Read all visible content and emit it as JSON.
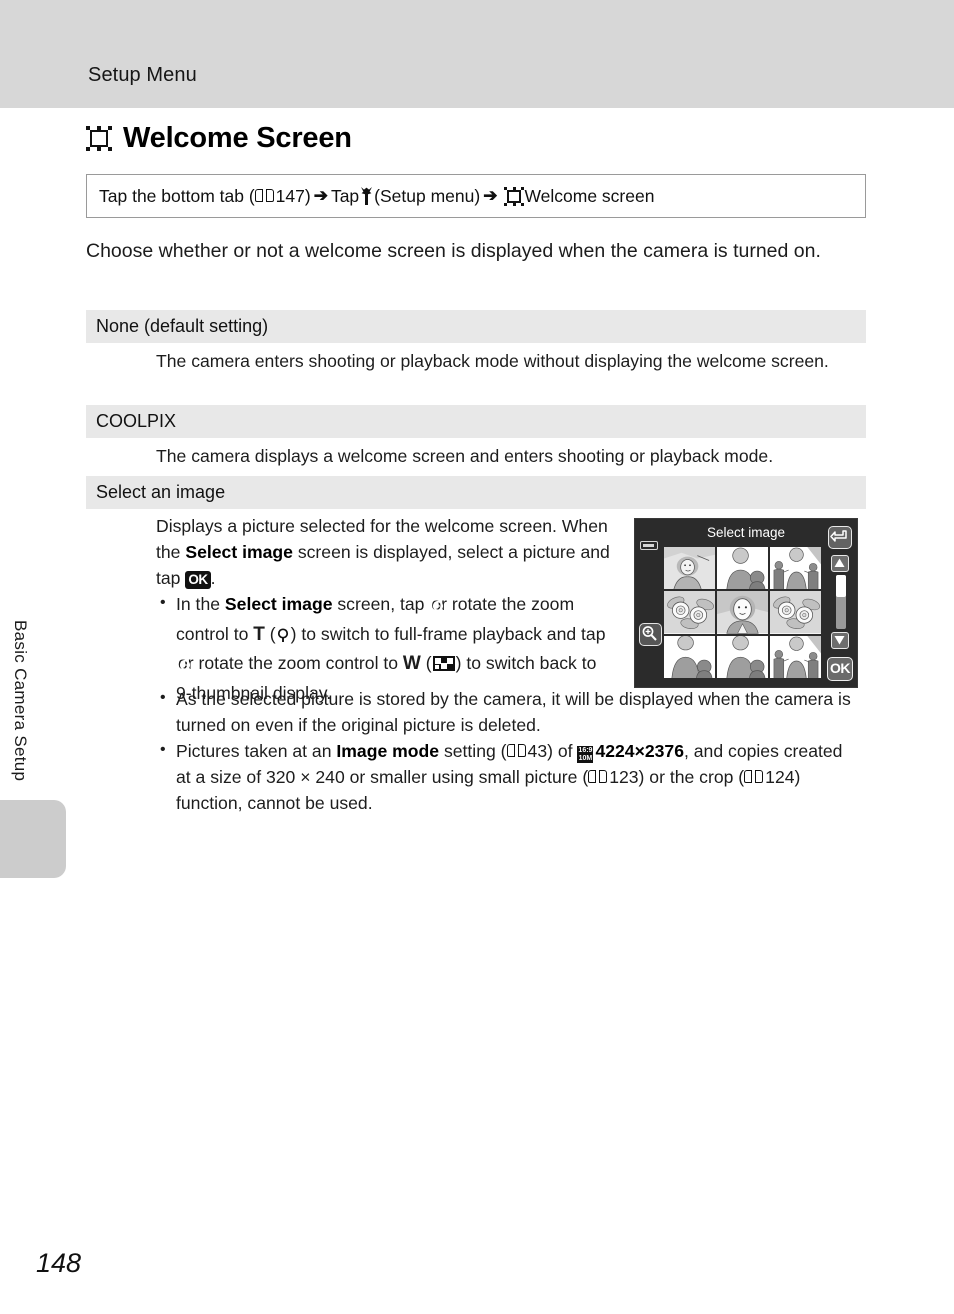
{
  "header": {
    "section_title": "Setup Menu"
  },
  "side_tab": {
    "label": "Basic Camera Setup"
  },
  "page": {
    "title": "Welcome Screen",
    "title_icon": "welcome-screen-frame-icon",
    "number": "148"
  },
  "nav_path": {
    "part1": "Tap the bottom tab (",
    "ref1": "147",
    "part2": ") ",
    "arrow": "➔",
    "part3": " Tap ",
    "wrench": "Y",
    "part4": " (Setup menu) ",
    "part5": " Welcome screen"
  },
  "intro": "Choose whether or not a welcome screen is displayed when the camera is turned on.",
  "options": [
    {
      "name": "None (default setting)",
      "body": "The camera enters shooting or playback mode without displaying the welcome screen."
    },
    {
      "name": "COOLPIX",
      "body": "The camera displays a welcome screen and enters shooting or playback mode."
    },
    {
      "name": "Select an image",
      "body_line1": "Displays a picture selected for the welcome screen.",
      "body_line2_a": "When the ",
      "body_line2_b": "Select image",
      "body_line2_c": " screen is displayed, select a picture and tap ",
      "body_line2_ok": "OK",
      "body_line2_d": "."
    }
  ],
  "bullets": {
    "b1_a": "In the ",
    "b1_bold": "Select image",
    "b1_b": " screen, tap ",
    "b1_c": " or rotate the zoom control to ",
    "b1_T": "T",
    "b1_d": " (",
    "b1_e": ") to switch to full-frame playback and tap ",
    "b1_f": " or rotate the zoom control to ",
    "b1_W": "W",
    "b1_g": " (",
    "b1_h": ") to switch back to 9-thumbnail display.",
    "b2": "As the selected picture is stored by the camera, it will be displayed when the camera is turned on even if the original picture is deleted.",
    "b3_a": "Pictures taken at an ",
    "b3_bold1": "Image mode",
    "b3_b": " setting (",
    "b3_ref1": "43",
    "b3_c": ") of ",
    "b3_icon_top": "16:9",
    "b3_icon_bottom": "10M",
    "b3_bold2": "4224×2376",
    "b3_d": ", and copies created at a size of 320 × 240 or smaller using small picture (",
    "b3_ref2": "123",
    "b3_e": ") or the crop (",
    "b3_ref3": "124",
    "b3_f": ") function, cannot be used."
  },
  "lcd": {
    "title": "Select image",
    "ok_label": "OK",
    "battery_icon": "battery-icon",
    "zoom_in_icon": "magnifier-zoom-in-icon",
    "back_icon": "back-arrow-icon",
    "up_icon": "scroll-up-triangle-icon",
    "down_icon": "scroll-down-triangle-icon",
    "scrollbar": "vertical-scrollbar",
    "thumbnails": [
      "portrait-outdoor",
      "woman-and-child",
      "family-three",
      "flowers-left",
      "woman-portrait",
      "flowers-right",
      "woman-and-child-2",
      "woman-and-child-3",
      "family-three-2"
    ],
    "selected_index": 0
  },
  "colors": {
    "header_band": "#d7d7d7",
    "option_row": "#e8e8e8",
    "side_tab": "#cccccc",
    "lcd_background": "#2b2b2b"
  }
}
